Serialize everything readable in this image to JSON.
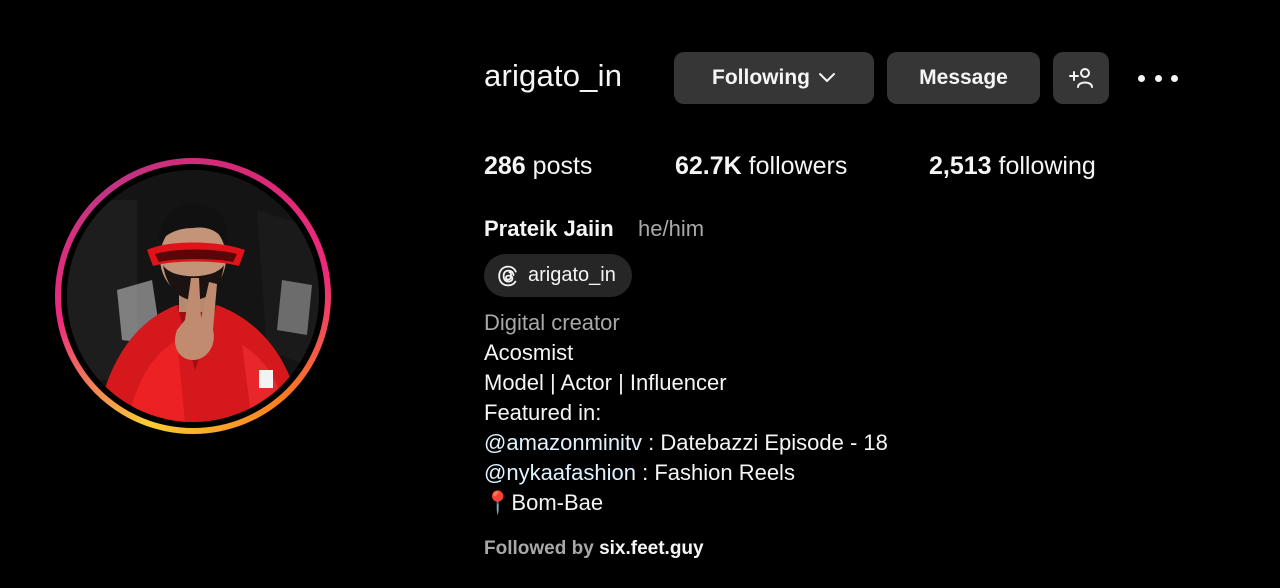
{
  "profile": {
    "username": "arigato_in",
    "full_name": "Prateik Jaiin",
    "pronouns": "he/him",
    "threads_handle": "arigato_in"
  },
  "actions": {
    "following_label": "Following",
    "message_label": "Message"
  },
  "stats": {
    "posts_count": "286",
    "posts_label": "posts",
    "followers_count": "62.7K",
    "followers_label": "followers",
    "following_count": "2,513",
    "following_label": "following"
  },
  "bio": {
    "category": "Digital creator",
    "lines": [
      "Acosmist",
      "Model | Actor | Influencer",
      "Featured in:"
    ],
    "mention_1": "@amazonminitv",
    "mention_1_rest": " : Datebazzi Episode - 18",
    "mention_2": "@nykaafashion",
    "mention_2_rest": " : Fashion Reels",
    "location_emoji": "📍",
    "location": "Bom-Bae"
  },
  "followed_by": {
    "prefix": "Followed by ",
    "user": "six.feet.guy"
  },
  "icons": {
    "following_dropdown": "chevron-down-icon",
    "add_user": "add-user-icon",
    "more": "more-options-icon",
    "threads": "threads-icon"
  },
  "colors": {
    "background": "#000000",
    "button": "#363636",
    "text_primary": "#f5f5f5",
    "text_secondary": "#a8a8a8",
    "mention": "#e0f1ff"
  }
}
